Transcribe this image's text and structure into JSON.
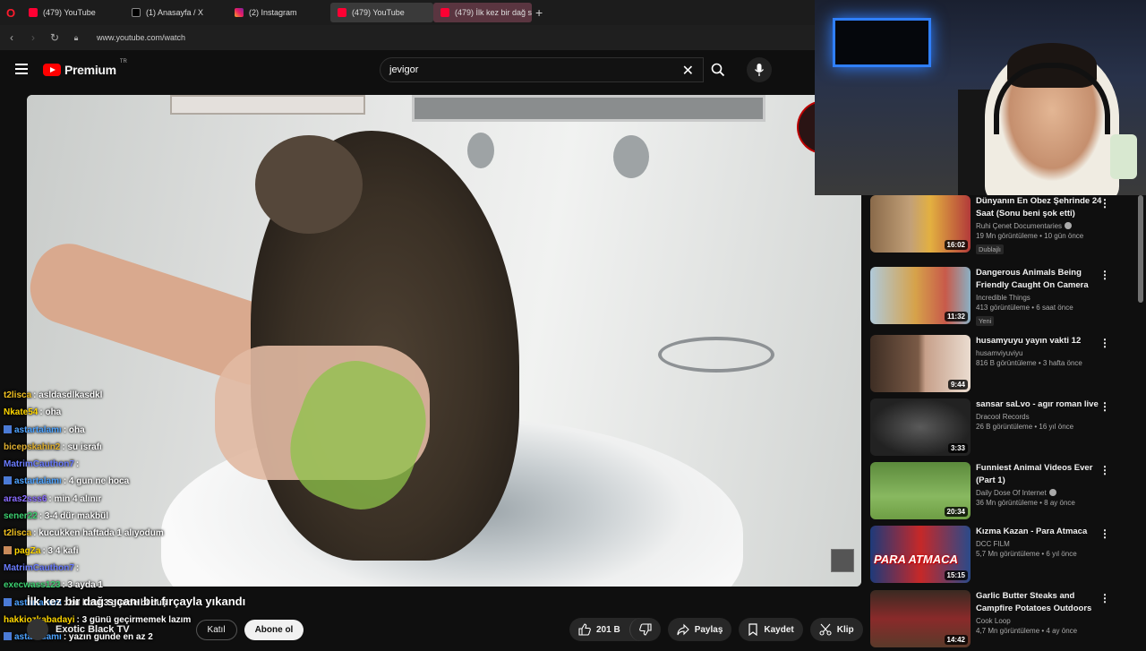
{
  "browser": {
    "tabs": [
      {
        "title": "(479) YouTube",
        "icon": "youtube-icon"
      },
      {
        "title": "(1) Anasayfa / X",
        "icon": "x-icon"
      },
      {
        "title": "(2) Instagram",
        "icon": "instagram-icon"
      },
      {
        "title": "(479) YouTube",
        "icon": "youtube-icon"
      },
      {
        "title": "(479) İlk kez bir dağ sıçan",
        "icon": "youtube-icon"
      }
    ],
    "new_tab": "+",
    "url": "www.youtube.com/watch"
  },
  "header": {
    "logo_text": "Premium",
    "logo_sup": "TR",
    "search_value": "jevigor",
    "clear_glyph": "✕"
  },
  "video": {
    "title": "İlk kez bir dağ sıçanı bir fırçayla yıkandı",
    "channel": "Exotic Black TV",
    "join_label": "Katıl",
    "subscribe_label": "Abone ol",
    "likes": "201 B",
    "share_label": "Paylaş",
    "save_label": "Kaydet",
    "clip_label": "Klip",
    "more_glyph": "···"
  },
  "chat": [
    {
      "user": "t2lisca",
      "color": "#f0c020",
      "text": ": asldasdlkasdkl",
      "icon": false
    },
    {
      "user": "Nkate54",
      "color": "#ffd700",
      "text": ": oha",
      "icon": false
    },
    {
      "user": "astartalamı",
      "color": "#4da3ff",
      "text": ": oha",
      "icon": true
    },
    {
      "user": "bicepskahin2",
      "color": "#e0b030",
      "text": ": su israfı",
      "icon": false
    },
    {
      "user": "MatrimCauthon7",
      "color": "#6a7cff",
      "text": ":",
      "icon": false
    },
    {
      "user": "astartalamı",
      "color": "#4da3ff",
      "text": ": 4 gun ne hoca",
      "icon": true
    },
    {
      "user": "aras2sss6",
      "color": "#8a6cff",
      "text": ": min 4 alınır",
      "icon": false
    },
    {
      "user": "sener22",
      "color": "#3cd070",
      "text": ": 3-4 dür makbül",
      "icon": false
    },
    {
      "user": "t2lisca",
      "color": "#f0c020",
      "text": ": kucukken haftada 1 alıyodum",
      "icon": false
    },
    {
      "user": "pagZa",
      "color": "#ffd700",
      "text": ": 3 4 kafi",
      "icon": true
    },
    {
      "user": "MatrimCauthon7",
      "color": "#6a7cff",
      "text": ":",
      "icon": false
    },
    {
      "user": "execwass123",
      "color": "#3cd070",
      "text": ": 3 ayda 1",
      "icon": false
    },
    {
      "user": "astartalamı",
      "color": "#4da3ff",
      "text": ": bu kotu 3 günde bi duş",
      "icon": true
    },
    {
      "user": "hakkiozkabadayi",
      "color": "#ffd700",
      "text": ": 3 günü geçirmemek lazım",
      "icon": false
    },
    {
      "user": "astartalamı",
      "color": "#4da3ff",
      "text": ": yazın gunde en az 2",
      "icon": true
    }
  ],
  "recommendations": [
    {
      "title": "Dünyanın En Obez Şehrinde 24 Saat (Sonu beni şok etti)",
      "channel": "Ruhi Çenet Documentaries",
      "verified": true,
      "meta": "19 Mn görüntüleme • 10 gün önce",
      "tag": "Dublajlı",
      "duration": "16:02"
    },
    {
      "title": "Dangerous Animals Being Friendly Caught On Camera",
      "channel": "Incredible Things",
      "verified": false,
      "meta": "413 görüntüleme • 6 saat önce",
      "tag": "Yeni",
      "duration": "11:32"
    },
    {
      "title": "husamyuyu yayın vakti 12",
      "channel": "husamviyuviyu",
      "verified": false,
      "meta": "816 B görüntüleme • 3 hafta önce",
      "tag": "",
      "duration": "9:44"
    },
    {
      "title": "sansar saLvo - agır roman live",
      "channel": "Dracool Records",
      "verified": false,
      "meta": "26 B görüntüleme • 16 yıl önce",
      "tag": "",
      "duration": "3:33"
    },
    {
      "title": "Funniest Animal Videos Ever (Part 1)",
      "channel": "Daily Dose Of Internet",
      "verified": true,
      "meta": "36 Mn görüntüleme • 8 ay önce",
      "tag": "",
      "duration": "20:34"
    },
    {
      "title": "Kızma Kazan - Para Atmaca",
      "channel": "DCC FILM",
      "verified": false,
      "meta": "5,7 Mn görüntüleme • 6 yıl önce",
      "tag": "",
      "duration": "15:15",
      "thumb_text": "PARA ATMACA"
    },
    {
      "title": "Garlic Butter Steaks and Campfire Potatoes Outdoors",
      "channel": "Cook Loop",
      "verified": false,
      "meta": "4,7 Mn görüntüleme • 4 ay önce",
      "tag": "",
      "duration": "14:42"
    }
  ]
}
